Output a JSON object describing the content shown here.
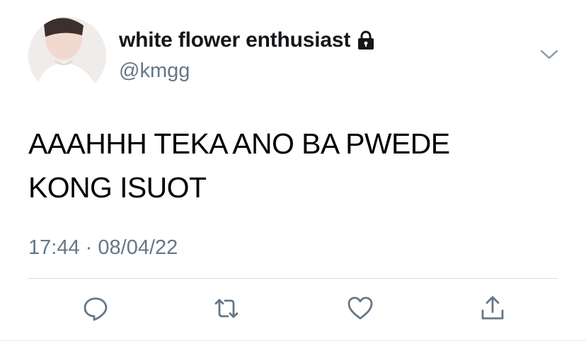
{
  "user": {
    "display_name": "white flower enthusiast",
    "handle": "@kmgg",
    "protected_icon": "lock-icon"
  },
  "tweet": {
    "text": "AAAHHH TEKA ANO BA PWEDE KONG ISUOT",
    "time": "17:44",
    "separator": "·",
    "date": "08/04/22"
  },
  "actions": {
    "reply_icon": "reply-icon",
    "retweet_icon": "retweet-icon",
    "like_icon": "heart-icon",
    "share_icon": "share-icon"
  },
  "colors": {
    "text_primary": "#14171a",
    "text_secondary": "#657786",
    "divider": "#d7dbde",
    "icon": "#657786"
  }
}
